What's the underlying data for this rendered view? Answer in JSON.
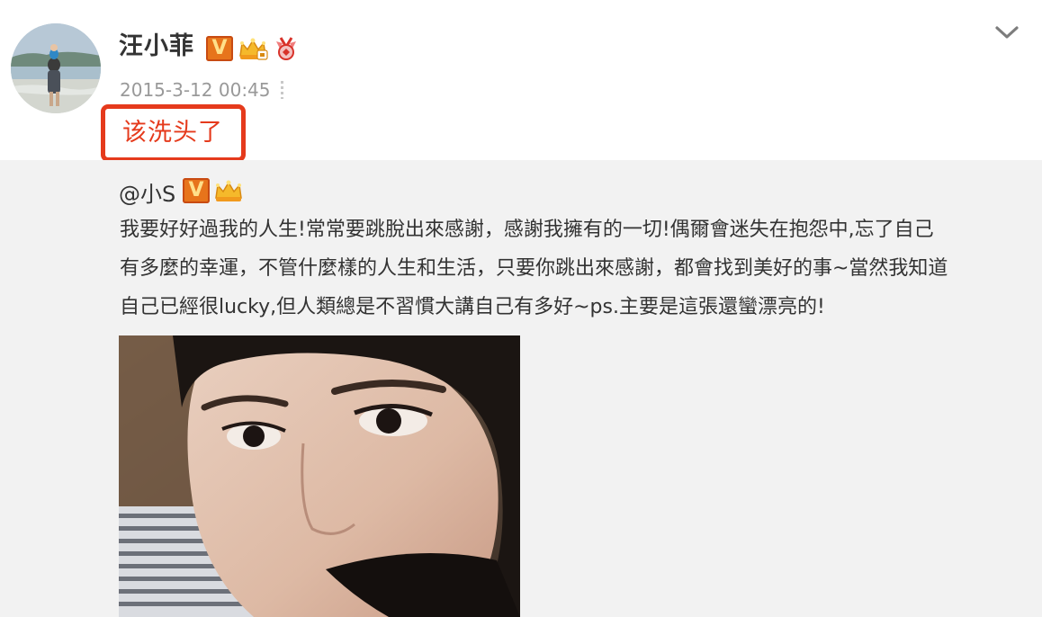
{
  "post": {
    "username": "汪小菲",
    "timestamp": "2015-3-12 00:45",
    "content": "该洗头了",
    "badges": [
      "verified-v-badge",
      "crown-badge",
      "medal-badge"
    ]
  },
  "repost": {
    "author": "@小S",
    "badges": [
      "verified-v-badge",
      "crown-badge"
    ],
    "text_lines": [
      "我要好好過我的人生!常常要跳脫出來感謝，感謝我擁有的一切!偶爾會迷失在抱怨中,忘了自己",
      "有多麼的幸運，不管什麼樣的人生和生活，只要你跳出來感謝，都會找到美好的事~當然我知道",
      "自己已經很lucky,但人類總是不習慣大講自己有多好~ps.主要是這張還蠻漂亮的!"
    ]
  },
  "icons": {
    "menu": "chevron-down-icon",
    "verified": "V"
  },
  "colors": {
    "highlight_border": "#e53a1c",
    "repost_bg": "#f2f2f2",
    "username": "#333333",
    "timestamp": "#999999",
    "verified_badge": "#e7741b"
  }
}
